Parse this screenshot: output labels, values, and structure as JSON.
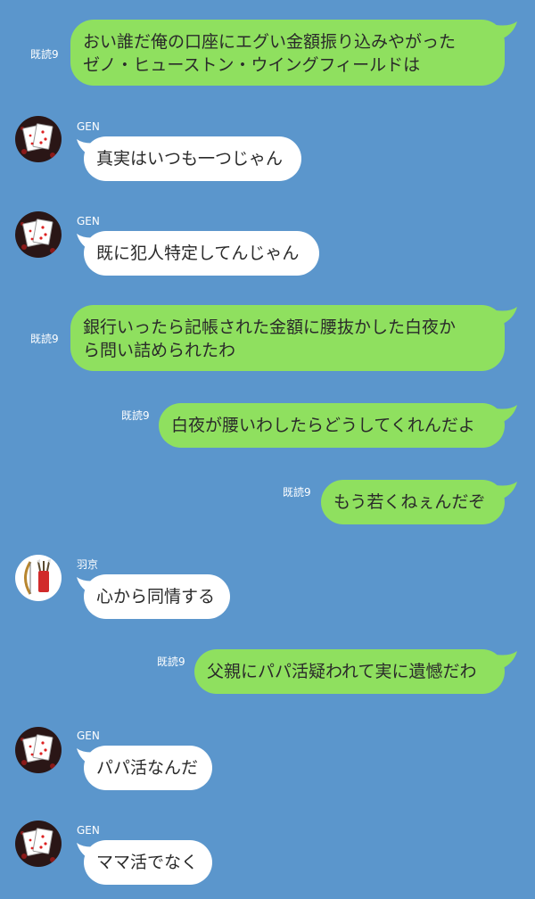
{
  "chat": {
    "read_label": "既読9",
    "messages": [
      {
        "type": "out",
        "text": "おい誰だ俺の口座にエグい金額振り込みやがった\nゼノ・ヒューストン・ウイングフィールドは"
      },
      {
        "type": "in",
        "sender": "GEN",
        "avatar": "cards-avatar",
        "text": "真実はいつも一つじゃん"
      },
      {
        "type": "in",
        "sender": "GEN",
        "avatar": "cards-avatar",
        "text": "既に犯人特定してんじゃん"
      },
      {
        "type": "out",
        "text": "銀行いったら記帳された金額に腰抜かした白夜か\nら問い詰められたわ"
      },
      {
        "type": "out",
        "text": "白夜が腰いわしたらどうしてくれんだよ"
      },
      {
        "type": "out",
        "text": "もう若くねぇんだぞ"
      },
      {
        "type": "in",
        "sender": "羽京",
        "avatar": "bow-quiver-avatar",
        "text": "心から同情する"
      },
      {
        "type": "out",
        "text": "父親にパパ活疑われて実に遺憾だわ"
      },
      {
        "type": "in",
        "sender": "GEN",
        "avatar": "cards-avatar",
        "text": "パパ活なんだ"
      },
      {
        "type": "in",
        "sender": "GEN",
        "avatar": "cards-avatar",
        "text": "ママ活でなく"
      }
    ]
  }
}
